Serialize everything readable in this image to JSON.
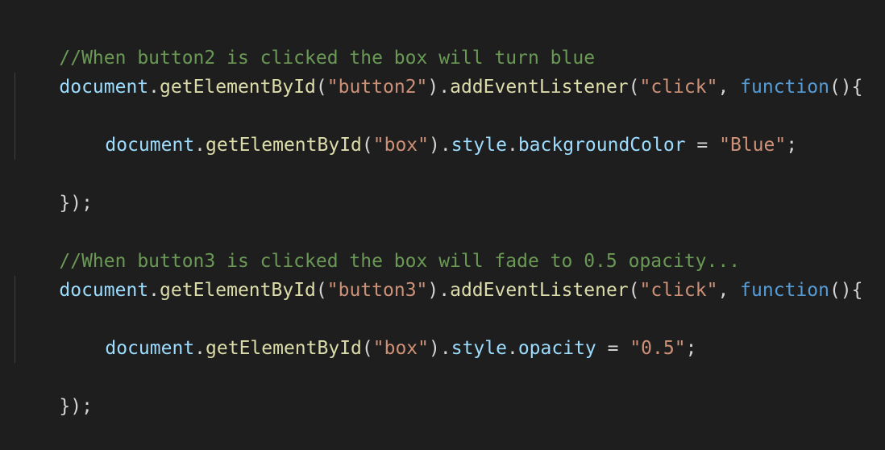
{
  "code": {
    "lines": [
      {
        "type": "comment",
        "text": "//When button2 is clicked the box will turn blue"
      },
      {
        "type": "listener",
        "target": "document",
        "fn": "getElementById",
        "arg": "\"button2\"",
        "method": "addEventListener",
        "event": "\"click\"",
        "keyword": "function"
      },
      {
        "type": "blank"
      },
      {
        "type": "assign",
        "target": "document",
        "fn": "getElementById",
        "arg": "\"box\"",
        "prop1": "style",
        "prop2": "backgroundColor",
        "value": "\"Blue\""
      },
      {
        "type": "blank"
      },
      {
        "type": "close",
        "text": "});"
      },
      {
        "type": "blank"
      },
      {
        "type": "comment",
        "text": "//When button3 is clicked the box will fade to 0.5 opacity..."
      },
      {
        "type": "listener",
        "target": "document",
        "fn": "getElementById",
        "arg": "\"button3\"",
        "method": "addEventListener",
        "event": "\"click\"",
        "keyword": "function"
      },
      {
        "type": "blank"
      },
      {
        "type": "assign",
        "target": "document",
        "fn": "getElementById",
        "arg": "\"box\"",
        "prop1": "style",
        "prop2": "opacity",
        "value": "\"0.5\""
      },
      {
        "type": "blank"
      },
      {
        "type": "close",
        "text": "});"
      }
    ]
  },
  "colors": {
    "background": "#1e1e1e",
    "comment": "#6a9955",
    "identifier": "#9cdcfe",
    "function": "#dcdcaa",
    "string": "#ce9178",
    "keyword": "#569cd6",
    "punctuation": "#d4d4d4"
  }
}
